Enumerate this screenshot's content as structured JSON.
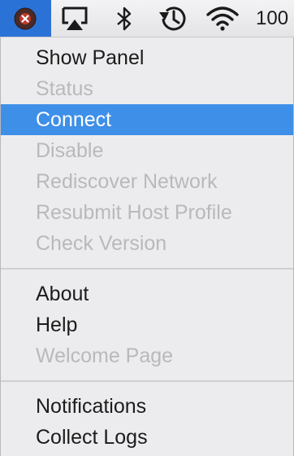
{
  "menubar": {
    "icons": [
      "app-status-icon",
      "airplay-icon",
      "bluetooth-icon",
      "time-machine-icon",
      "wifi-icon"
    ],
    "battery_text": "100",
    "active_color": "#2b72d6"
  },
  "menu": {
    "highlight_color": "#3e8fe8",
    "groups": [
      [
        {
          "label": "Show Panel",
          "enabled": true
        },
        {
          "label": "Status",
          "enabled": false
        },
        {
          "label": "Connect",
          "enabled": true,
          "highlighted": true
        },
        {
          "label": "Disable",
          "enabled": false
        },
        {
          "label": "Rediscover Network",
          "enabled": false
        },
        {
          "label": "Resubmit Host Profile",
          "enabled": false
        },
        {
          "label": "Check Version",
          "enabled": false
        }
      ],
      [
        {
          "label": "About",
          "enabled": true
        },
        {
          "label": "Help",
          "enabled": true
        },
        {
          "label": "Welcome Page",
          "enabled": false
        }
      ],
      [
        {
          "label": "Notifications",
          "enabled": true
        },
        {
          "label": "Collect Logs",
          "enabled": true
        }
      ]
    ]
  }
}
